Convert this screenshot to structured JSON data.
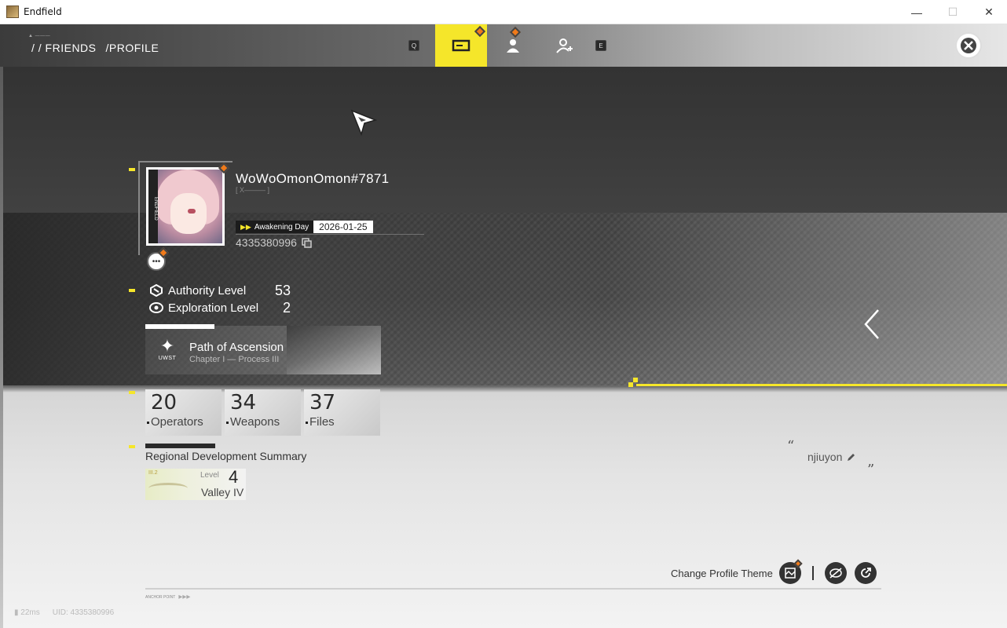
{
  "window": {
    "title": "Endfield",
    "minimize": "—",
    "maximize": "☐",
    "close": "✕"
  },
  "nav": {
    "breadcrumb": [
      "/ / FRIENDS",
      "/PROFILE"
    ],
    "key_left": "Q",
    "key_right": "E"
  },
  "profile": {
    "username": "WoWoOmonOmon#7871",
    "subtag": "[ X——— ]",
    "awakening_label": "Awakening Day",
    "awakening_date": "2026-01-25",
    "uid": "4335380996",
    "avatar_side_text": "ENDFIELD"
  },
  "levels": [
    {
      "name": "Authority Level",
      "value": "53"
    },
    {
      "name": "Exploration Level",
      "value": "2"
    }
  ],
  "ascension": {
    "logo_text": "UWST",
    "title": "Path of Ascension",
    "subtitle": "Chapter I — Process III"
  },
  "stats": [
    {
      "value": "20",
      "label": "Operators"
    },
    {
      "value": "34",
      "label": "Weapons"
    },
    {
      "value": "37",
      "label": "Files"
    }
  ],
  "region": {
    "title": "Regional Development Summary",
    "level_label": "Level",
    "level_value": "4",
    "name": "Valley IV"
  },
  "signature": {
    "text": "njiuyon"
  },
  "actions": {
    "change_theme_label": "Change Profile Theme"
  },
  "footer": {
    "anchor": "ANCHOR POINT",
    "ping": "22ms",
    "uid": "UID: 4335380996"
  },
  "colors": {
    "accent": "#f5e62a",
    "badge": "#f07a1a"
  }
}
